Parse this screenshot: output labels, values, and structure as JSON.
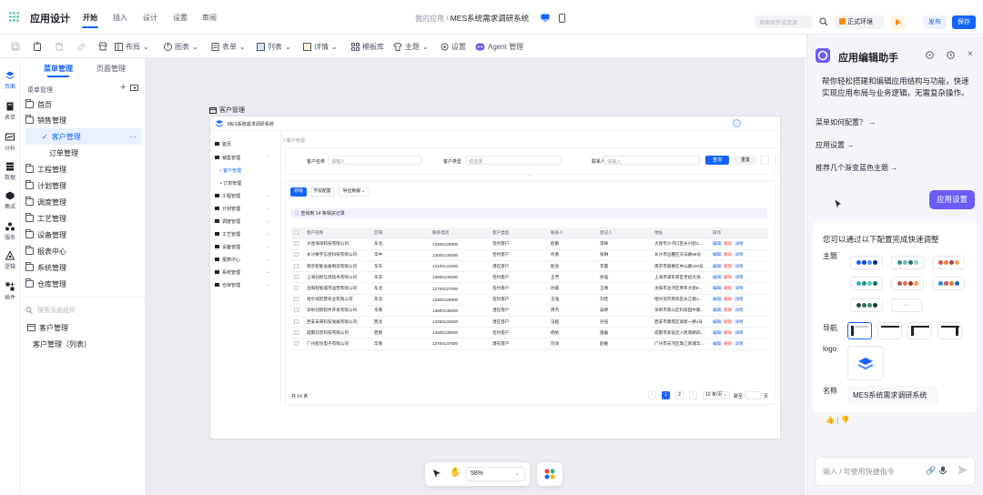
{
  "app": {
    "name": "应用设计"
  },
  "top_nav": [
    {
      "label": "开始",
      "active": true
    },
    {
      "label": "插入"
    },
    {
      "label": "设计"
    },
    {
      "label": "设置"
    },
    {
      "label": "审阅"
    }
  ],
  "breadcrumb": {
    "parent": "我的应用",
    "sep": "/",
    "current": "MES系统需求调研系统"
  },
  "search": {
    "placeholder": "搜索组件或资源"
  },
  "env": {
    "label": "正式环境"
  },
  "buttons": {
    "publish": "发布",
    "save": "保存"
  },
  "toolbar": {
    "layout": "布局",
    "chart": "图表",
    "form": "表单",
    "list": "列表",
    "detail": "详情",
    "templates": "模板库",
    "theme": "主题",
    "settings": "设置",
    "agent": "Agent 管理"
  },
  "rail": [
    {
      "label": "页面",
      "icon": "page-icon"
    },
    {
      "label": "表单",
      "icon": "form-icon"
    },
    {
      "label": "分析",
      "icon": "analysis-icon"
    },
    {
      "label": "数据",
      "icon": "data-icon"
    },
    {
      "label": "集成",
      "icon": "integration-icon"
    },
    {
      "label": "服务",
      "icon": "service-icon"
    },
    {
      "label": "逻辑",
      "icon": "logic-icon"
    },
    {
      "label": "插件",
      "icon": "plugin-icon"
    }
  ],
  "menu_panel": {
    "tabs": [
      "菜单管理",
      "页面管理"
    ],
    "section": "菜单管理",
    "items": [
      {
        "label": "首页"
      },
      {
        "label": "销售管理"
      },
      {
        "label": "客户管理"
      },
      {
        "label": "订单管理"
      },
      {
        "label": "工程管理"
      },
      {
        "label": "计划管理"
      },
      {
        "label": "调度管理"
      },
      {
        "label": "工艺管理"
      },
      {
        "label": "设备管理"
      },
      {
        "label": "报表中心"
      },
      {
        "label": "系统管理"
      },
      {
        "label": "仓库管理"
      }
    ],
    "search_placeholder": "搜索页面组件",
    "page_tree": [
      "客户管理",
      "客户管理（列表）"
    ]
  },
  "preview": {
    "frame_title": "客户管理",
    "app_title": "MES系统需求调研系统",
    "breadcrumb": "/ 客户管理",
    "side": [
      {
        "label": "首页"
      },
      {
        "label": "销售管理"
      },
      {
        "label": "客户管理"
      },
      {
        "label": "订单管理"
      },
      {
        "label": "工程管理"
      },
      {
        "label": "计划管理"
      },
      {
        "label": "调度管理"
      },
      {
        "label": "工艺管理"
      },
      {
        "label": "设备管理"
      },
      {
        "label": "报表中心"
      },
      {
        "label": "系统管理"
      },
      {
        "label": "仓库管理"
      }
    ],
    "filters": {
      "name_label": "客户名称",
      "name_ph": "请输入",
      "type_label": "客户类型",
      "type_ph": "请选择",
      "contact_label": "联系人",
      "contact_ph": "请输入",
      "query": "查询",
      "reset": "重置"
    },
    "actions": {
      "add": "新增",
      "fields": "字段配置",
      "export": "导出数据"
    },
    "count_text": "查询到 14 条相关记录",
    "columns": [
      "客户名称",
      "区域",
      "联系电话",
      "客户类型",
      "联系人",
      "登记人",
      "地址",
      "操作"
    ],
    "rows": [
      [
        "大连海洋科技有限公司",
        "东北",
        "12600126000",
        "签约客户",
        "赵鹏",
        "李婷",
        "大连市沙河口区长兴街1..."
      ],
      [
        "长沙数字信息科技有限公司",
        "华中",
        "13000130000",
        "签约客户",
        "何勇",
        "张琳",
        "长沙市岳麓区天马路88号"
      ],
      [
        "南京智能设备制造有限公司",
        "华东",
        "13100131000",
        "潜在客户",
        "赵亮",
        "李蕾",
        "南京市鼓楼区中山路100号"
      ],
      [
        "上海创新信息技术有限公司",
        "华东",
        "13600136000",
        "签约客户",
        "王芳",
        "徐强",
        "上海市浦东新区世纪大道..."
      ],
      [
        "沈阳智能城市运营有限公司",
        "东北",
        "12700127000",
        "签约客户",
        "孙晨",
        "王倩",
        "沈阳市沈河区青年大街8..."
      ],
      [
        "哈尔滨智慧农业有限公司",
        "东北",
        "12900129000",
        "签约客户",
        "王强",
        "刘佳",
        "哈尔滨市南岗区长江路1..."
      ],
      [
        "深圳创新软件开发有限公司",
        "华南",
        "13600136000",
        "潜在客户",
        "周杰",
        "吴婷",
        "深圳市南山区科技园中路..."
      ],
      [
        "西安未来科技发展有限公司",
        "西北",
        "13450134000",
        "潜在客户",
        "马超",
        "孙浩",
        "西安市雁塔区高新一路1号"
      ],
      [
        "成都云智科技有限公司",
        "西南",
        "13500135000",
        "签约客户",
        "杨帆",
        "唐磊",
        "成都市武侯区人民南路四..."
      ],
      [
        "广州智创电子有限公司",
        "华南",
        "13700137000",
        "潜在客户",
        "刘洋",
        "赵敏",
        "广州市天河区珠江新城华..."
      ]
    ],
    "op": {
      "edit": "编辑",
      "del": "删除",
      "detail": "详情"
    },
    "total": "共 14 条",
    "pages": [
      "1",
      "2"
    ],
    "page_size": "10 条/页",
    "goto": "跳至",
    "page_unit": "页"
  },
  "zoom": {
    "value": "58%"
  },
  "assistant": {
    "title": "应用编辑助手",
    "intro": "帮你轻松搭建和编辑应用结构与功能，快速实现应用布局与业务逻辑，无需复杂操作。",
    "suggestions": [
      "菜单如何配置？ →",
      "应用设置 →",
      "推荐几个渐变蓝色主题 →"
    ],
    "user_msg": "应用设置",
    "config_title": "您可以通过以下配置完成快速调整",
    "theme_label": "主题",
    "nav_label": "导航",
    "logo_label": "logo",
    "name_label": "名称",
    "name_value": "MES系统需求调研系统",
    "input_placeholder": "输入 / 可使用快捷指令",
    "more": "···"
  },
  "colors": {
    "accent": "#1664ff",
    "assistant_btn": "#6a5cf6",
    "env_orange": "#ff8a00",
    "del": "#f53f3f"
  }
}
